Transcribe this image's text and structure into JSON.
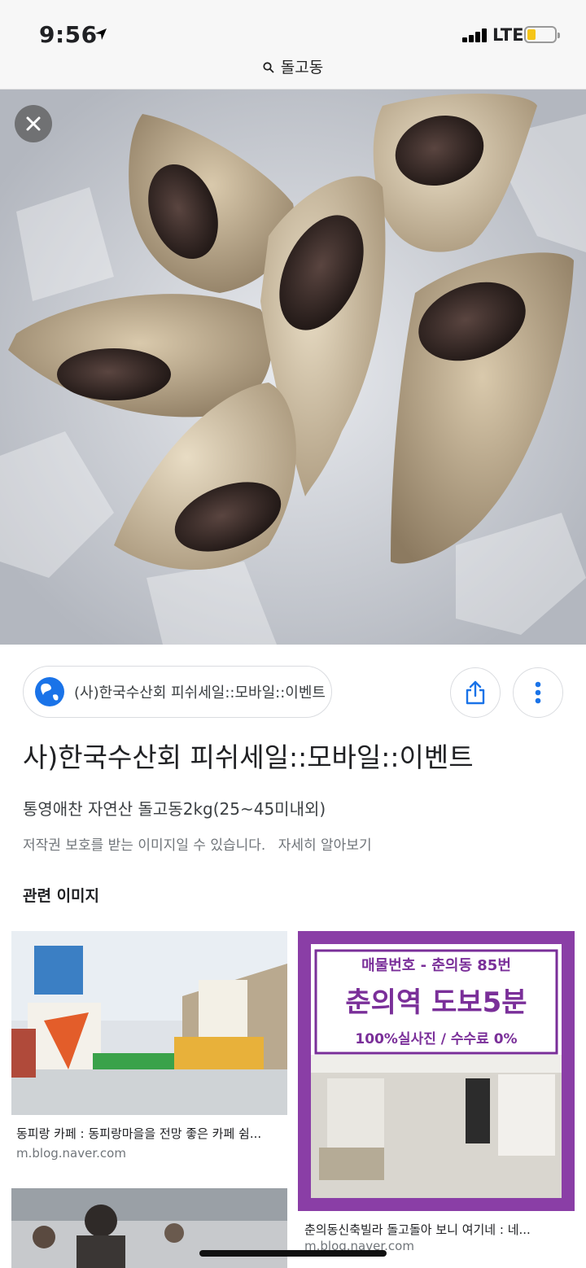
{
  "status_bar": {
    "time": "9:56",
    "network": "LTE"
  },
  "address_bar": {
    "query": "돌고동"
  },
  "result": {
    "source_name": "(사)한국수산회 피쉬세일::모바일::이벤트",
    "title": "사)한국수산회 피쉬세일::모바일::이벤트",
    "snippet": "통영애찬 자연산 돌고동2kg(25~45미내외)",
    "copyright_notice": "저작권 보호를 받는 이미지일 수 있습니다.",
    "learn_more": "자세히 알아보기"
  },
  "related": {
    "heading": "관련 이미지",
    "items": [
      {
        "caption": "동피랑 카페 : 동피랑마을을 전망 좋은 카페 쉼...",
        "domain": "m.blog.naver.com"
      },
      {
        "caption": "춘의동신축빌라 돌고돌아 보니 여기네 : 네...",
        "domain": "m.blog.naver.com",
        "ad_line1": "매물번호 - 춘의동 85번",
        "ad_line2": "춘의역 도보5분",
        "ad_line3": "100%실사진 / 수수료 0%"
      }
    ]
  },
  "colors": {
    "accent_blue": "#1a73e8",
    "ad_purple": "#8a3ea6",
    "battery_yellow": "#f5c518"
  }
}
